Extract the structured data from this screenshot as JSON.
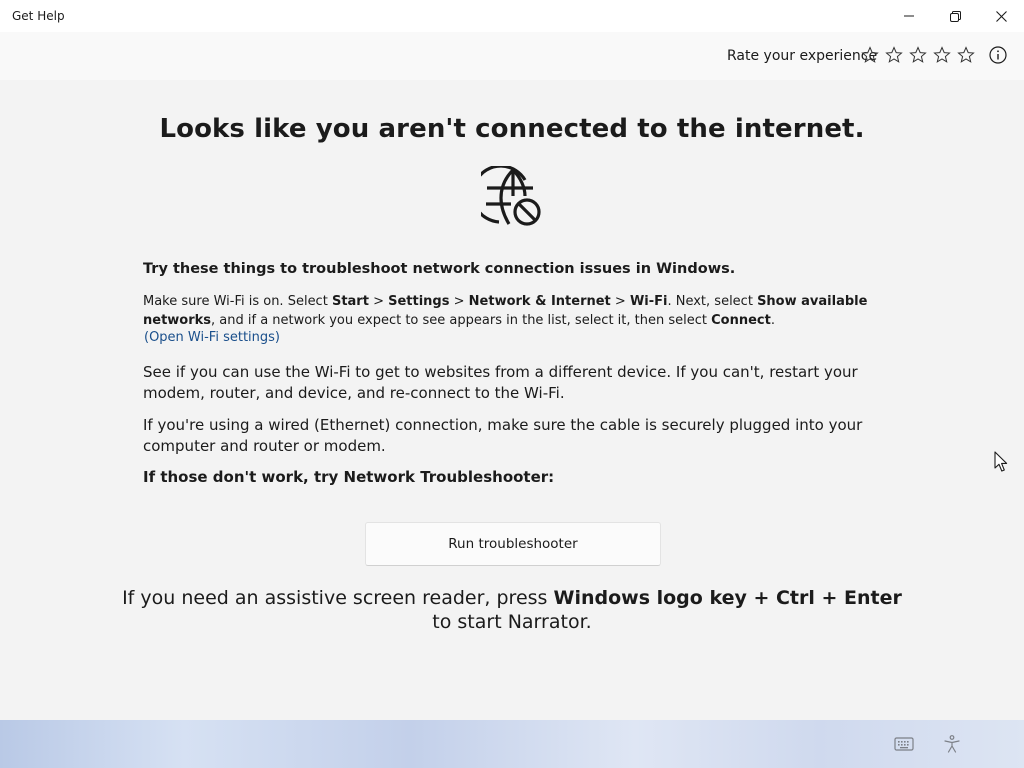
{
  "window": {
    "title": "Get Help",
    "controls": [
      "minimize-icon",
      "restore-icon",
      "close-icon"
    ]
  },
  "rating": {
    "label": "Rate your experience",
    "stars": 5,
    "info_icon": "info-icon"
  },
  "main": {
    "headline": "Looks like you aren't connected to the internet.",
    "globe_icon": "globe-blocked-icon",
    "heading": "Try these things to troubleshoot network connection issues in Windows.",
    "wifi": {
      "t1": "Make sure Wi-Fi is on. Select ",
      "start": "Start",
      "sep1": " > ",
      "settings": "Settings",
      "sep2": " > ",
      "network": "Network & Internet",
      "sep3": " > ",
      "wifi": "Wi-Fi",
      "t2": ". Next, select ",
      "show_networks": "Show available networks",
      "t3": ", and if a network you expect to see appears in the list, select it, then select ",
      "connect": "Connect",
      "t4": "."
    },
    "wifi_link": "(Open Wi-Fi settings)",
    "para1": "See if you can use the Wi-Fi to get to websites from a different device. If you can't, restart your modem, router, and device, and re-connect to the Wi-Fi.",
    "para2": "If you're using a wired (Ethernet) connection, make sure the cable is securely plugged into your computer and router or modem.",
    "troubleshoot_label": "If those don't work, try Network Troubleshooter:",
    "run_button": "Run troubleshooter",
    "narrator": {
      "t1": "If you need an assistive screen reader, press ",
      "keys": "Windows logo key + Ctrl + Enter",
      "t2": " to start Narrator."
    }
  },
  "taskbar": {
    "icons": [
      "keyboard-icon",
      "accessibility-icon"
    ]
  }
}
